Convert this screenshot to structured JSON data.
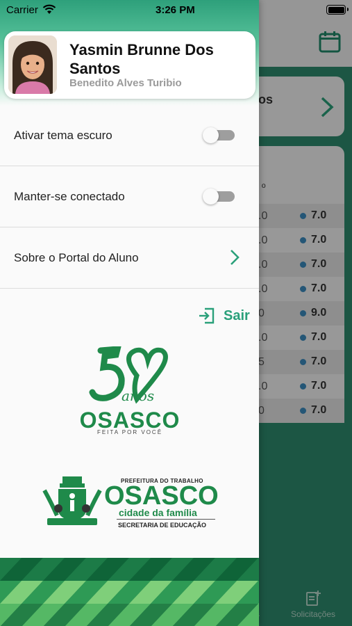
{
  "status_bar": {
    "carrier": "Carrier",
    "time": "3:26 PM"
  },
  "profile": {
    "student_name": "Yasmin Brunne Dos Santos",
    "school_name": "Benedito Alves Turibio"
  },
  "menu": {
    "dark_theme_label": "Ativar tema escuro",
    "dark_theme_on": false,
    "stay_connected_label": "Manter-se conectado",
    "stay_connected_on": false,
    "about_label": "Sobre o Portal do Aluno",
    "logout_label": "Sair"
  },
  "logos": {
    "anniversary_script": "anos",
    "city_name": "OSASCO",
    "city_tagline": "FEITA POR VOCÊ",
    "prefeitura_line": "PREFEITURA DO TRABALHO",
    "prefeitura_name": "OSASCO",
    "prefeitura_tagline": "cidade da família",
    "department": "SECRETARIA DE EDUCAÇÃO"
  },
  "background": {
    "card_partial_text": "os",
    "grade_header_partial": "º",
    "grade_rows": [
      {
        "left": ".0",
        "value": "7.0"
      },
      {
        "left": ".0",
        "value": "7.0"
      },
      {
        "left": ".0",
        "value": "7.0"
      },
      {
        "left": ".0",
        "value": "7.0"
      },
      {
        "left": "0",
        "value": "9.0"
      },
      {
        "left": ".0",
        "value": "7.0"
      },
      {
        "left": "5",
        "value": "7.0"
      },
      {
        "left": ".0",
        "value": "7.0"
      },
      {
        "left": "0",
        "value": "7.0"
      }
    ],
    "tab_partial": "s",
    "tab_solicitacoes": "Solicitações"
  },
  "colors": {
    "brand_green": "#2aa07a",
    "logo_green": "#1f8a4a",
    "background_green": "#2e8b6f"
  }
}
